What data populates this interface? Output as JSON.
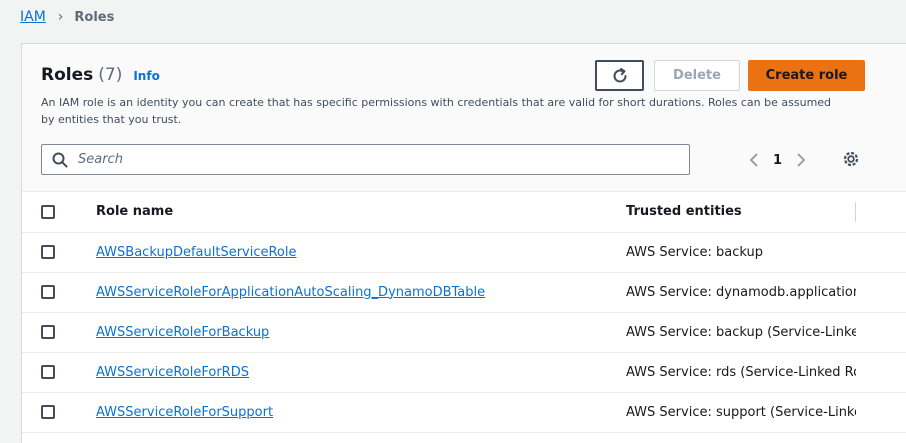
{
  "breadcrumb": {
    "root": "IAM",
    "separator": "›",
    "current": "Roles"
  },
  "header": {
    "title": "Roles",
    "count": "(7)",
    "info_label": "Info",
    "delete_label": "Delete",
    "create_label": "Create role",
    "description": "An IAM role is an identity you can create that has specific permissions with credentials that are valid for short durations. Roles can be assumed by entities that you trust."
  },
  "search": {
    "placeholder": "Search",
    "value": ""
  },
  "pagination": {
    "current_page": "1"
  },
  "table": {
    "columns": {
      "name": "Role name",
      "trusted": "Trusted entities"
    },
    "rows": [
      {
        "name": "AWSBackupDefaultServiceRole",
        "trusted_prefix": "AWS Service: backup",
        "trusted_link": ""
      },
      {
        "name": "AWSServiceRoleForApplicationAutoScaling_DynamoDBTable",
        "trusted_prefix": "AWS Service: dynamodb.application-",
        "trusted_link": ""
      },
      {
        "name": "AWSServiceRoleForBackup",
        "trusted_prefix": "AWS Service: backup ",
        "trusted_link": "(Service-Linked"
      },
      {
        "name": "AWSServiceRoleForRDS",
        "trusted_prefix": "AWS Service: rds ",
        "trusted_link": "(Service-Linked Role"
      },
      {
        "name": "AWSServiceRoleForSupport",
        "trusted_prefix": "AWS Service: support ",
        "trusted_link": "(Service-Linked"
      }
    ]
  },
  "colors": {
    "link": "#0972d3",
    "primary_button": "#ec7211",
    "text": "#16191f"
  },
  "icons": {
    "refresh": "refresh-icon",
    "search": "search-icon",
    "prev": "chevron-left-icon",
    "next": "chevron-right-icon",
    "settings": "gear-icon",
    "sort": "sort-ascending-icon"
  }
}
